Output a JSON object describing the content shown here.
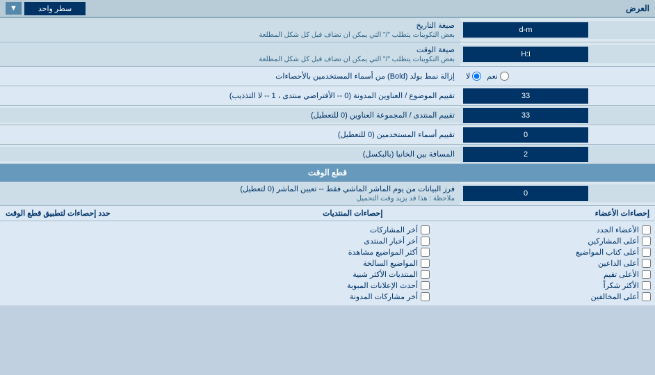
{
  "header": {
    "right_label": "العرض",
    "left_button": "سطر واحد",
    "dropdown_arrow": "▼"
  },
  "rows": [
    {
      "id": "date_format",
      "label_main": "صيغة التاريخ",
      "label_sub": "بعض التكوينات يتطلب \"/\" التي يمكن ان تضاف قبل كل شكل المطلعة",
      "value": "d-m",
      "type": "input"
    },
    {
      "id": "time_format",
      "label_main": "صيغة الوقت",
      "label_sub": "بعض التكوينات يتطلب \"/\" التي يمكن ان تضاف قبل كل شكل المطلعة",
      "value": "H:i",
      "type": "input"
    },
    {
      "id": "remove_bold",
      "label_main": "إزالة نمط بولد (Bold) من أسماء المستخدمين بالأحصاءات",
      "value_yes": "نعم",
      "value_no": "لا",
      "selected": "no",
      "type": "radio"
    },
    {
      "id": "topic_sort",
      "label_main": "تقييم الموضوع / العناوين المدونة (0 -- الأفتراضي منتدى ، 1 -- لا التذذيب)",
      "value": "33",
      "type": "input"
    },
    {
      "id": "forum_sort",
      "label_main": "تقييم المنتدى / المجموعة العناوين (0 للتعطيل)",
      "value": "33",
      "type": "input"
    },
    {
      "id": "user_sort",
      "label_main": "تقييم أسماء المستخدمين (0 للتعطيل)",
      "value": "0",
      "type": "input"
    },
    {
      "id": "gap",
      "label_main": "المسافة بين الخانيا (بالبكسل)",
      "value": "2",
      "type": "input"
    }
  ],
  "section_cutoff": {
    "title": "قطع الوقت"
  },
  "cutoff_row": {
    "label_main": "فرز البيانات من يوم الماشر الماشي فقط -- تعيين الماشر (0 لتعطيل)",
    "label_sub": "ملاحظة : هذا قد يزيد وقت التحميل",
    "value": "0"
  },
  "checkboxes_header": {
    "right_label": "حدد إحصاءات لتطبيق قطع الوقت",
    "col1_header": "إحصاءات المنتديات",
    "col2_header": "إحصاءات الأعضاء"
  },
  "checkboxes_col1": [
    {
      "id": "cb_shares",
      "label": "أخر المشاركات"
    },
    {
      "id": "cb_forum_news",
      "label": "أخر أخبار المنتدى"
    },
    {
      "id": "cb_most_viewed",
      "label": "أكثر المواضيع مشاهدة"
    },
    {
      "id": "cb_old_topics",
      "label": "المواضيع السالخة"
    },
    {
      "id": "cb_similar",
      "label": "المنتديات الأكثر شبية"
    },
    {
      "id": "cb_recent_ads",
      "label": "أحدث الإعلانات المبوبة"
    },
    {
      "id": "cb_forum_contributions",
      "label": "أخر مشاركات المدونة"
    }
  ],
  "checkboxes_col2": [
    {
      "id": "cb_new_members",
      "label": "الأعضاء الجدد"
    },
    {
      "id": "cb_top_posters",
      "label": "أعلى المشاركين"
    },
    {
      "id": "cb_top_writers",
      "label": "أعلى كتاب المواضيع"
    },
    {
      "id": "cb_top_posts",
      "label": "أعلى الداعين"
    },
    {
      "id": "cb_top_rated",
      "label": "الأعلى تقيم"
    },
    {
      "id": "cb_top_thanks",
      "label": "الأكثر شكراً"
    },
    {
      "id": "cb_top_referrers",
      "label": "أعلى المخالفين"
    }
  ]
}
